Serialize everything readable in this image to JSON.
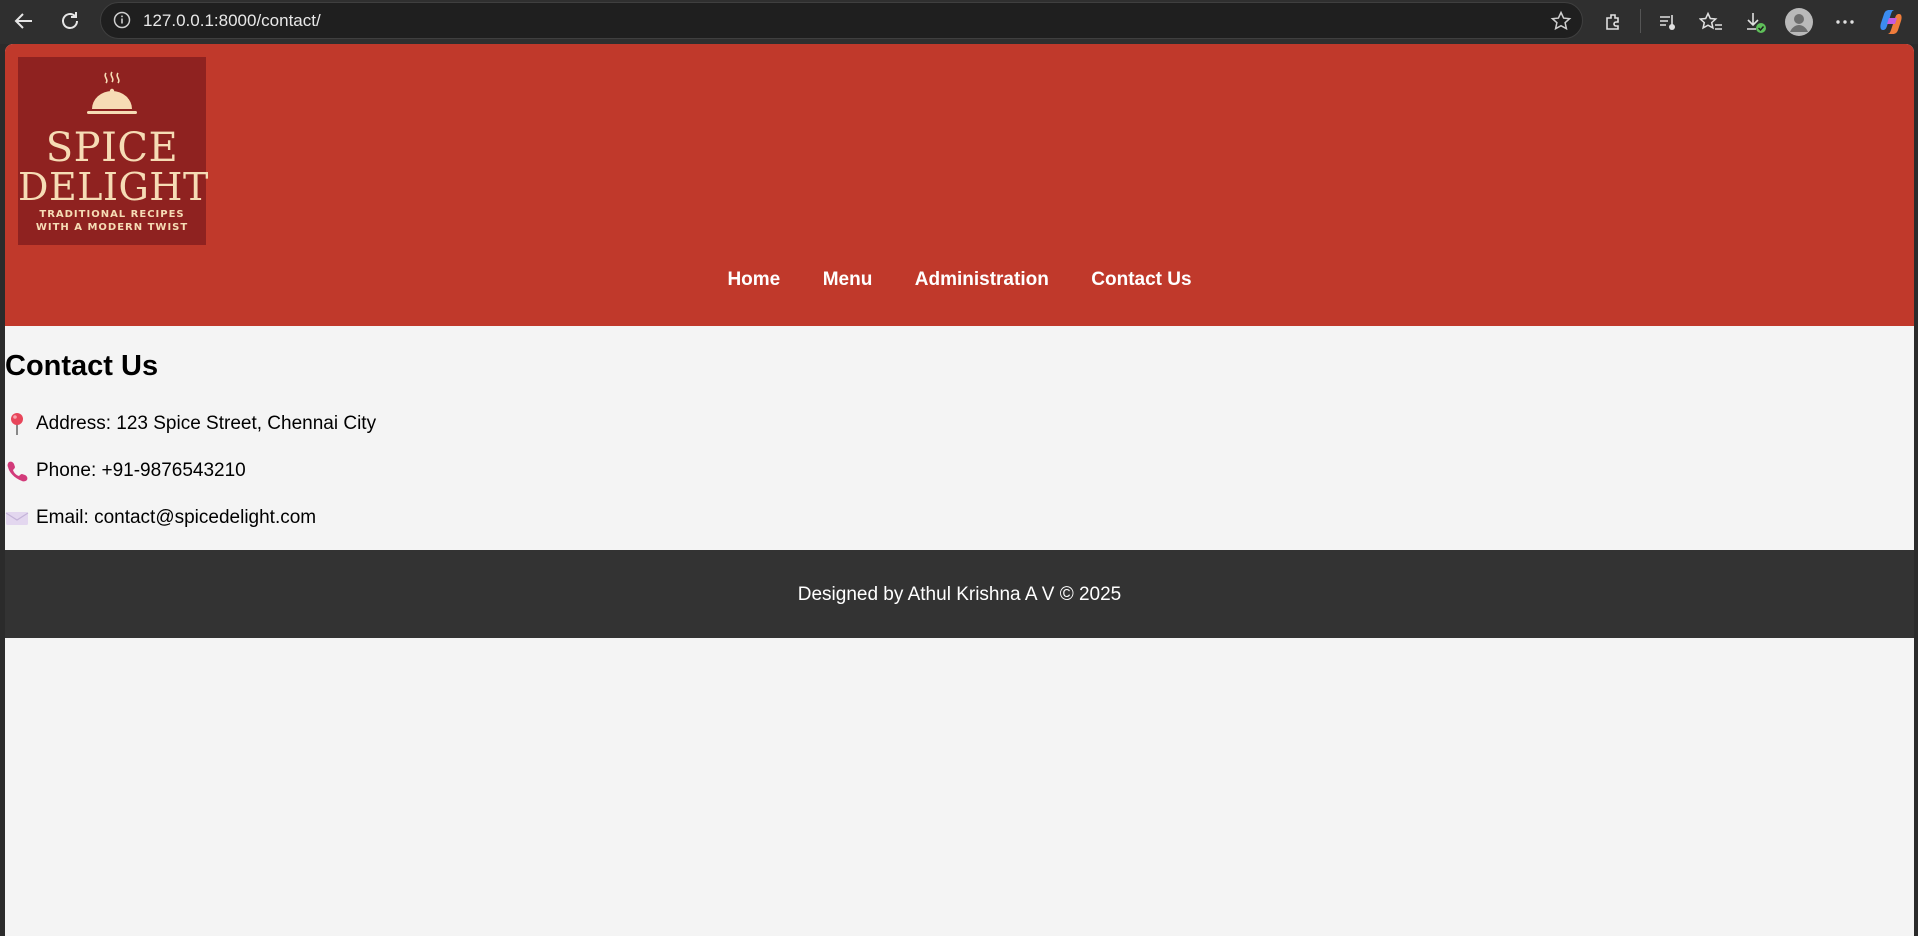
{
  "browser": {
    "url": "127.0.0.1:8000/contact/",
    "icons": [
      "back-icon",
      "refresh-icon",
      "info-icon",
      "star-icon",
      "extensions-icon",
      "media-icon",
      "favorites-icon",
      "downloads-icon",
      "profile-icon",
      "more-icon",
      "copilot-icon"
    ]
  },
  "site": {
    "logo": {
      "line1": "SPICE",
      "line2": "DELIGHT",
      "tagline1": "TRADITIONAL RECIPES",
      "tagline2": "WITH A MODERN TWIST"
    },
    "nav": [
      {
        "label": "Home"
      },
      {
        "label": "Menu"
      },
      {
        "label": "Administration"
      },
      {
        "label": "Contact Us"
      }
    ],
    "colors": {
      "header": "#c0392b",
      "footer": "#333333",
      "background": "#f4f4f4"
    }
  },
  "contact": {
    "title": "Contact Us",
    "address": "Address: 123 Spice Street, Chennai City",
    "phone": "Phone: +91-9876543210",
    "email": "Email: contact@spicedelight.com"
  },
  "footer": {
    "text": "Designed by Athul Krishna A V © 2025"
  }
}
